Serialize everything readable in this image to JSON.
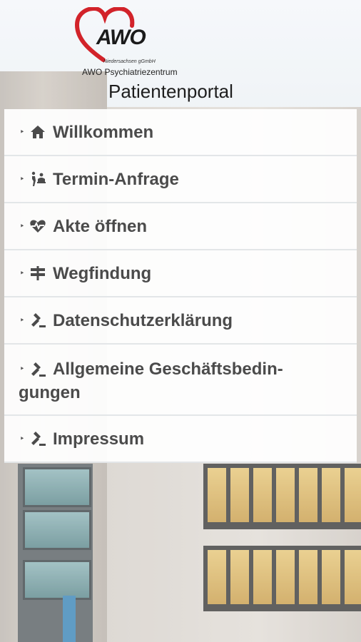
{
  "header": {
    "logo_text": "AWO",
    "logo_subtitle": "Niedersachsen gGmbH",
    "logo_org": "AWO Psychiatriezentrum",
    "portal_title": "Patientenportal"
  },
  "menu": {
    "items": [
      {
        "label": "Willkommen",
        "icon": "home-icon"
      },
      {
        "label": "Termin-Anfrage",
        "icon": "appointment-icon"
      },
      {
        "label": "Akte öffnen",
        "icon": "heartbeat-icon"
      },
      {
        "label": "Wegfindung",
        "icon": "signpost-icon"
      },
      {
        "label": "Datenschutzerklärung",
        "icon": "gavel-icon"
      },
      {
        "label_line1": "Allgemeine Geschäftsbedin-",
        "label_line2": "gungen",
        "icon": "gavel-icon"
      },
      {
        "label": "Impressum",
        "icon": "gavel-icon"
      }
    ]
  },
  "colors": {
    "logo_red": "#d2232a",
    "menu_text": "#4b4b4b"
  }
}
